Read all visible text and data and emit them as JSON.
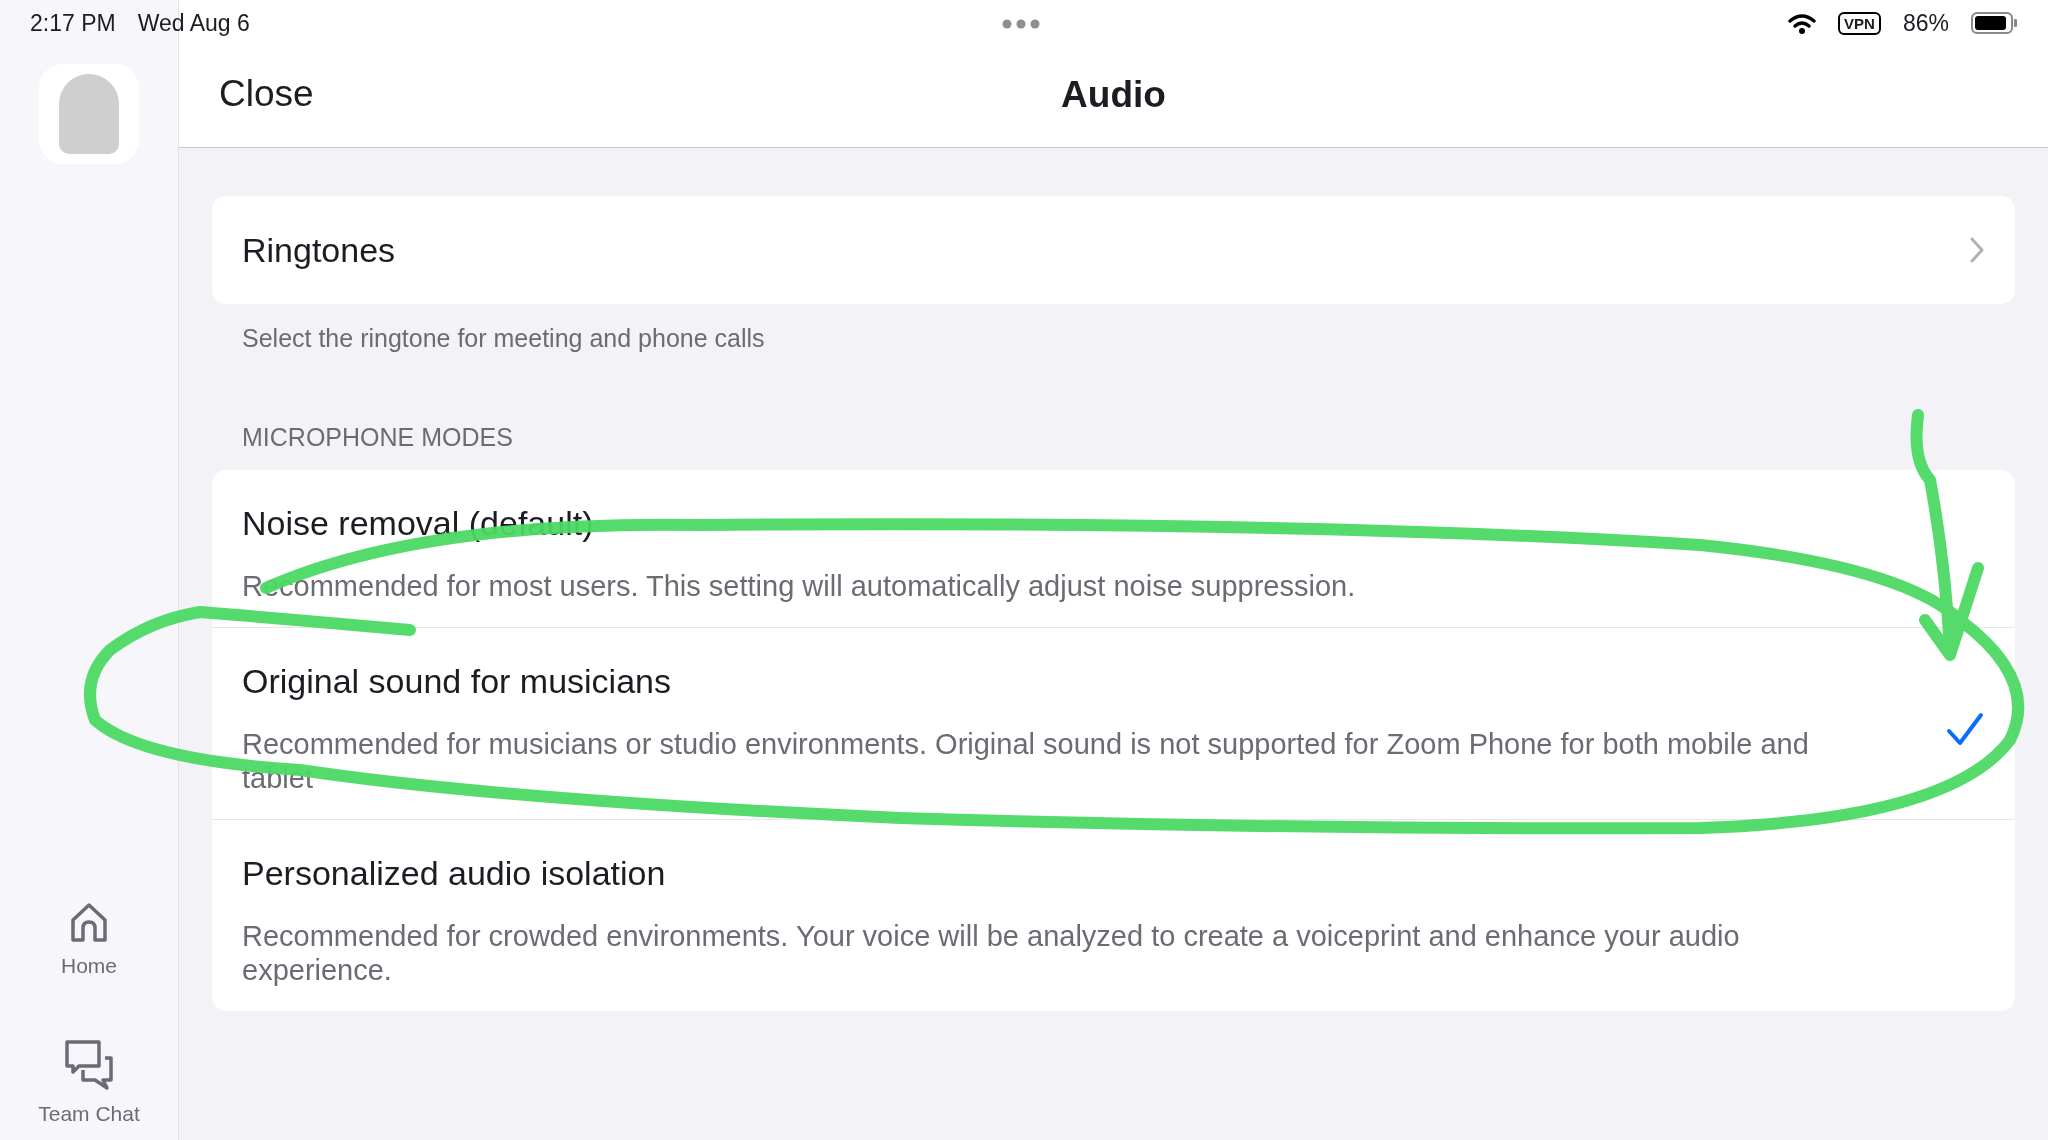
{
  "status_bar": {
    "time": "2:17 PM",
    "date": "Wed Aug 6",
    "vpn": "VPN",
    "battery": "86%"
  },
  "sidebar": {
    "items": [
      {
        "label": "Home",
        "selected": false
      },
      {
        "label": "Team Chat",
        "selected": false
      }
    ]
  },
  "header": {
    "close": "Close",
    "title": "Audio"
  },
  "ringtones": {
    "title": "Ringtones",
    "caption": "Select the ringtone for meeting and phone calls"
  },
  "microphone_modes": {
    "heading": "MICROPHONE MODES",
    "options": [
      {
        "title": "Noise removal (default)",
        "description": "Recommended for most users. This setting will automatically adjust noise suppression.",
        "selected": false
      },
      {
        "title": "Original sound for musicians",
        "description": "Recommended for musicians or studio environments. Original sound is not supported for Zoom Phone for both mobile and tablet",
        "selected": true
      },
      {
        "title": "Personalized audio isolation",
        "description": "Recommended for crowded environments. Your voice will be analyzed to create a voiceprint and enhance your audio experience.",
        "selected": false
      }
    ]
  }
}
